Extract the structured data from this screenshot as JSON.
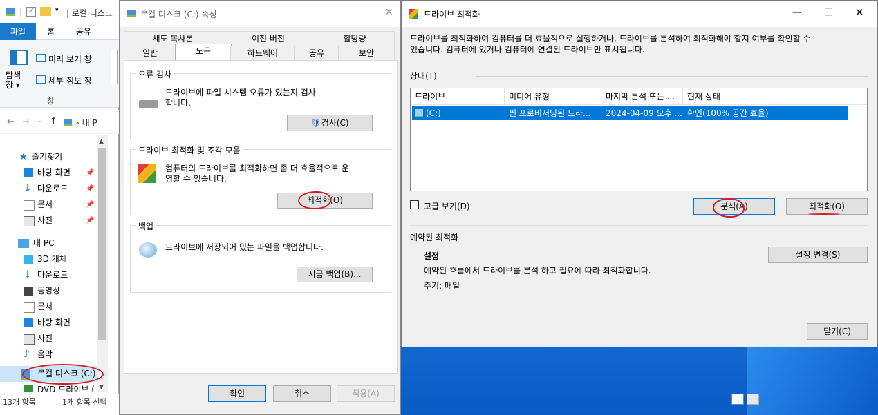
{
  "explorer": {
    "title": "| 로컬 디스크",
    "tabs": [
      "파일",
      "홈",
      "공유"
    ],
    "ribbon": {
      "preview_label": "미리 보기 창",
      "details_label": "세부 정보 창",
      "nav_pane_label": "탐색\n창 ▾",
      "group_label": "창"
    },
    "address": "› 내 P",
    "nav": {
      "quick_access": "즐겨찾기",
      "quick_items": [
        "바탕 화면",
        "다운로드",
        "문서",
        "사진"
      ],
      "this_pc": "내 PC",
      "pc_items": [
        "3D 개체",
        "다운로드",
        "동영상",
        "문서",
        "바탕 화면",
        "사진",
        "음악",
        "로컬 디스크 (C:)",
        "DVD 드라이브 ("
      ]
    },
    "status_items": "13개 항목",
    "status_selected": "1개 항목 선택"
  },
  "properties": {
    "title": "로컬 디스크 (C:) 속성",
    "tabs_top": [
      "섀도 복사본",
      "이전 버전",
      "할당량"
    ],
    "tabs_bottom": [
      "일반",
      "도구",
      "하드웨어",
      "공유",
      "보안"
    ],
    "error_check": {
      "label": "오류 검사",
      "description": "드라이브에 파일 시스템 오류가 있는지 검사\n합니다.",
      "button": "검사(C)"
    },
    "optimize": {
      "label": "드라이브 최적화 및 조각 모음",
      "description": "컴퓨터의 드라이브를 최적화하면 좀 더 효율적으로 운\n영할 수 있습니다.",
      "button": "최적화(O)"
    },
    "backup": {
      "label": "백업",
      "description": "드라이브에 저장되어 있는 파일을 백업합니다.",
      "button": "지금 백업(B)..."
    },
    "footer": {
      "ok": "확인",
      "cancel": "취소",
      "apply": "적용(A)"
    }
  },
  "optimizer": {
    "title": "드라이브 최적화",
    "intro": "드라이브를 최적화하여 컴퓨터를 더 효율적으로 실행하거나, 드라이브를 분석하여 최적화해야 할지 여부를 확인할 수\n있습니다. 컴퓨터에 있거나 컴퓨터에 연결된 드라이브만 표시됩니다.",
    "status_label": "상태(T)",
    "columns": [
      "드라이브",
      "미디어 유형",
      "마지막 분석 또는 ...",
      "현재 상태"
    ],
    "rows": [
      {
        "drive": "(C:)",
        "media": "씬 프로비저닝된 드라...",
        "last": "2024-04-09 오후 ...",
        "state": "확인(100% 공간 효율)"
      }
    ],
    "advanced_view": "고급 보기(D)",
    "analyze_button": "분석(A)",
    "optimize_button": "최적화(O)",
    "scheduled_label": "예약된 최적화",
    "settings_label": "설정",
    "settings_desc": "예약된 흐름에서 드라이브를 분석 하고 필요에 따라 최적화합니다.",
    "frequency": "주기: 매일",
    "change_settings_button": "설정 변경(S)",
    "close_button": "닫기(C)"
  },
  "colors": {
    "accent": "#0078d7",
    "annotation": "#d21f26",
    "file_tab": "#1979ca"
  }
}
